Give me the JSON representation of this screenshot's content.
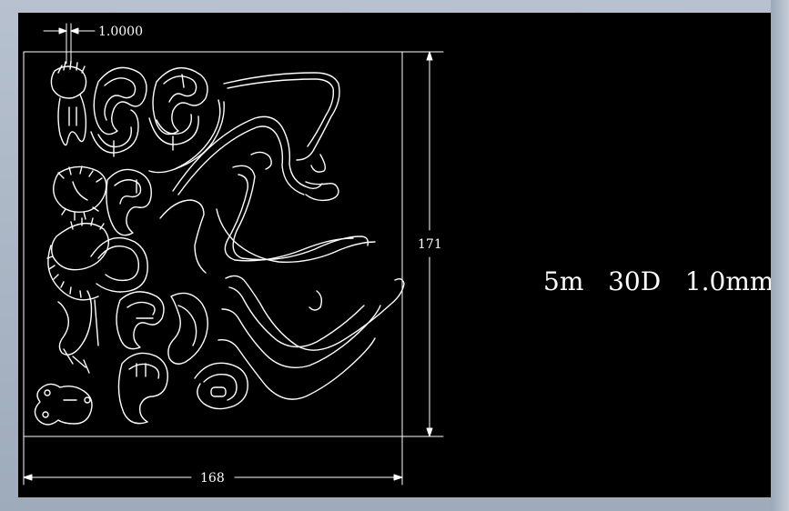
{
  "drawing": {
    "background": "#000000",
    "line_color": "#ffffff",
    "dimensions": {
      "top": "1.0000",
      "right": "171",
      "bottom": "168"
    },
    "note": "5m   30D   1.0mm"
  }
}
